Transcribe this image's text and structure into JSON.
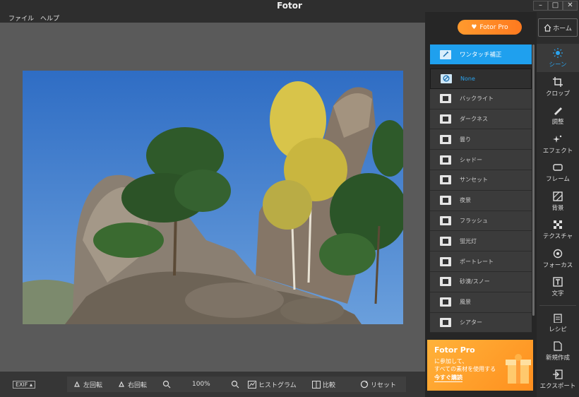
{
  "app": {
    "title": "Fotor"
  },
  "menu": {
    "file": "ファイル",
    "help": "ヘルプ"
  },
  "window_controls": {
    "minimize": "–",
    "maximize": "□",
    "close": "✕"
  },
  "pro_button": "Fotor Pro",
  "home_button": "ホーム",
  "one_click": "ワンタッチ補正",
  "scenes": [
    {
      "label": "None",
      "icon": "none-icon",
      "selected": true
    },
    {
      "label": "バックライト",
      "icon": "backlight-icon"
    },
    {
      "label": "ダークネス",
      "icon": "darkness-icon"
    },
    {
      "label": "曇り",
      "icon": "cloudy-icon"
    },
    {
      "label": "シャドー",
      "icon": "shadow-icon"
    },
    {
      "label": "サンセット",
      "icon": "sunset-icon"
    },
    {
      "label": "夜景",
      "icon": "night-icon"
    },
    {
      "label": "フラッシュ",
      "icon": "flash-icon"
    },
    {
      "label": "蛍光灯",
      "icon": "fluorescent-icon"
    },
    {
      "label": "ポートレート",
      "icon": "portrait-icon"
    },
    {
      "label": "砂漠/スノー",
      "icon": "desert-snow-icon"
    },
    {
      "label": "風景",
      "icon": "landscape-icon"
    },
    {
      "label": "シアター",
      "icon": "theater-icon"
    }
  ],
  "banner": {
    "title": "Fotor Pro",
    "line1": "に参加して、",
    "line2": "すべての素材を使用する",
    "link": "今すぐ購読"
  },
  "sidebar": [
    {
      "label": "シーン",
      "icon": "scene-icon",
      "active": true
    },
    {
      "label": "クロップ",
      "icon": "crop-icon"
    },
    {
      "label": "調整",
      "icon": "adjust-icon"
    },
    {
      "label": "エフェクト",
      "icon": "effect-icon"
    },
    {
      "label": "フレーム",
      "icon": "frame-icon"
    },
    {
      "label": "背景",
      "icon": "background-icon"
    },
    {
      "label": "テクスチャ",
      "icon": "texture-icon"
    },
    {
      "label": "フォーカス",
      "icon": "focus-icon"
    },
    {
      "label": "文字",
      "icon": "text-icon"
    },
    {
      "label": "レシピ",
      "icon": "recipe-icon"
    },
    {
      "label": "新規作成",
      "icon": "new-icon"
    },
    {
      "label": "エクスポート",
      "icon": "export-icon"
    }
  ],
  "bottom": {
    "exif": "EXIF",
    "rotate_left": "左回転",
    "rotate_right": "右回転",
    "zoom": "100%",
    "histogram": "ヒストグラム",
    "compare": "比較",
    "reset": "リセット"
  },
  "colors": {
    "accent": "#1fa0ee",
    "pro": "#ff8a24",
    "sky": "#3f78c4"
  }
}
